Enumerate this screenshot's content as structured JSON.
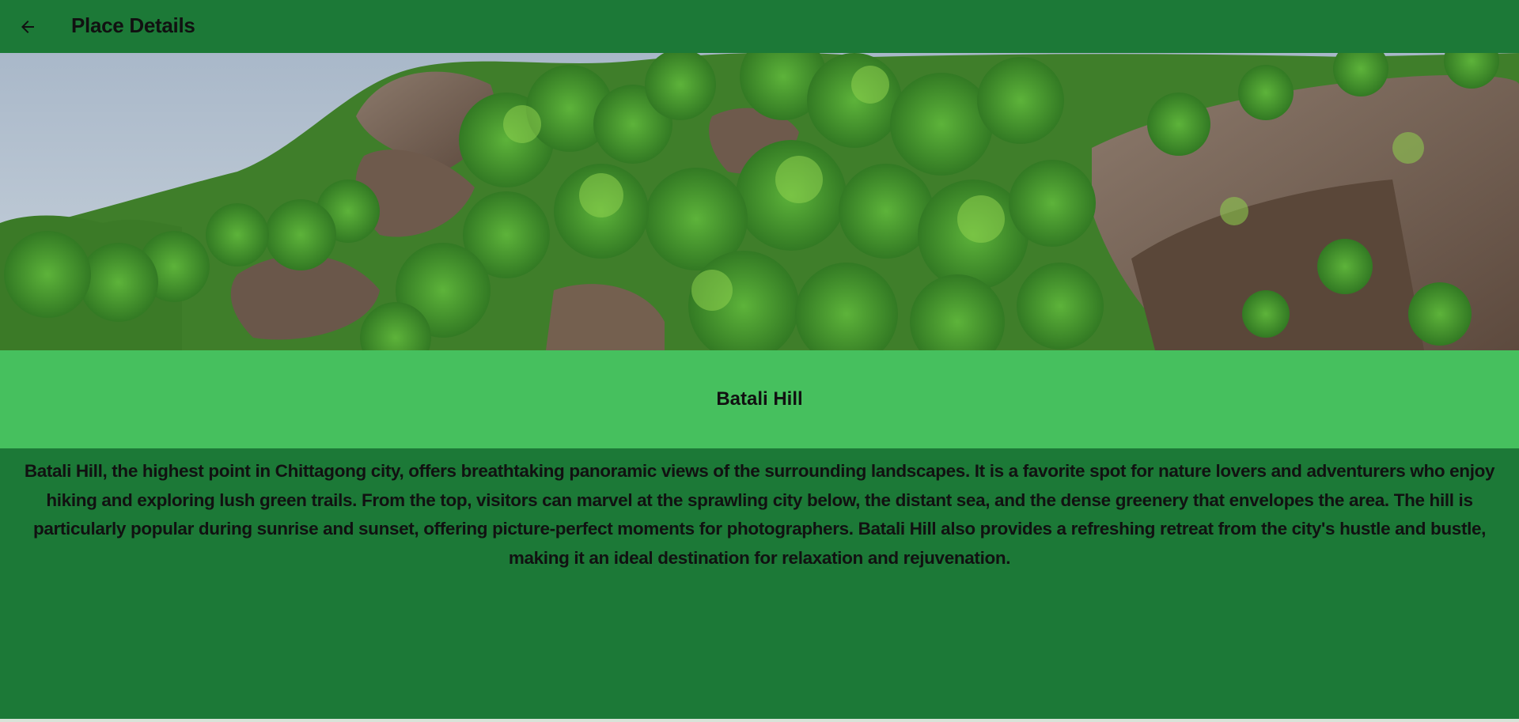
{
  "appbar": {
    "title": "Place Details",
    "back_icon": "arrow-left-icon"
  },
  "hero": {
    "image_subject": "green forested rocky hill under pale sky"
  },
  "place": {
    "name": "Batali Hill",
    "description": "Batali Hill, the highest point in Chittagong city, offers breathtaking panoramic views of the surrounding landscapes. It is a favorite spot for nature lovers and adventurers who enjoy hiking and exploring lush green trails. From the top, visitors can marvel at the sprawling city below, the distant sea, and the dense greenery that envelopes the area. The hill is particularly popular during sunrise and sunset, offering picture-perfect moments for photographers. Batali Hill also provides a refreshing retreat from the city's hustle and bustle, making it an ideal destination for relaxation and rejuvenation."
  },
  "colors": {
    "appbar_bg": "#1c7937",
    "name_band_bg": "#46c05e",
    "body_bg": "#1c7937",
    "text": "#111111"
  }
}
